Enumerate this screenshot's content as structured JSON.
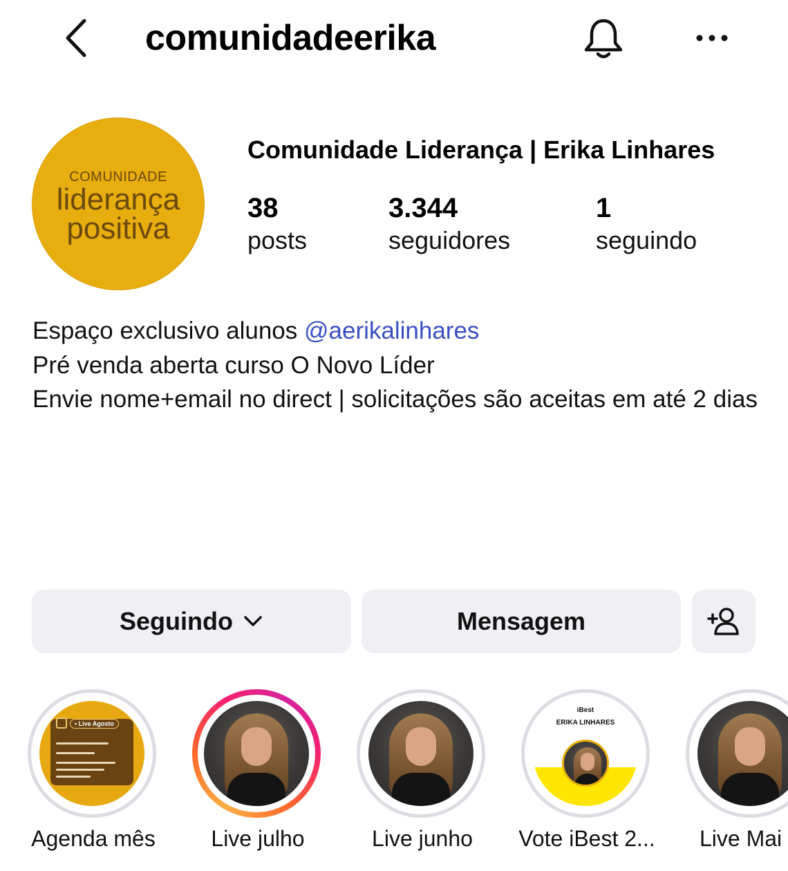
{
  "header": {
    "username": "comunidadeerika"
  },
  "profile": {
    "avatar": {
      "line1": "COMUNIDADE",
      "line2": "liderança",
      "line3": "positiva",
      "bg_color": "#e8ad0e"
    },
    "full_name": "Comunidade Liderança | Erika Linhares",
    "stats": {
      "posts": {
        "value": "38",
        "label": "posts"
      },
      "followers": {
        "value": "3.344",
        "label": "seguidores"
      },
      "following": {
        "value": "1",
        "label": "seguindo"
      }
    },
    "bio": {
      "line1_text": "Espaço exclusivo alunos ",
      "line1_mention": "@aerikalinhares",
      "line2": "Pré venda aberta curso O Novo Líder",
      "line3": "Envie nome+email no direct | solicitações são aceitas em até 2 dias"
    },
    "mention_color": "#3a4fc2"
  },
  "actions": {
    "following_label": "Seguindo",
    "message_label": "Mensagem"
  },
  "highlights": [
    {
      "label": "Agenda mês",
      "cover_title": "• Live Agosto"
    },
    {
      "label": "Live julho"
    },
    {
      "label": "Live junho"
    },
    {
      "label": "Vote iBest 2...",
      "cover_top": "iBest",
      "cover_name": "ERIKA LINHARES"
    },
    {
      "label": "Live Mai"
    }
  ],
  "icons": {
    "back": "chevron-left-icon",
    "bell": "bell-icon",
    "more": "more-horizontal-icon",
    "dropdown": "chevron-down-icon",
    "add_user": "add-user-icon"
  }
}
